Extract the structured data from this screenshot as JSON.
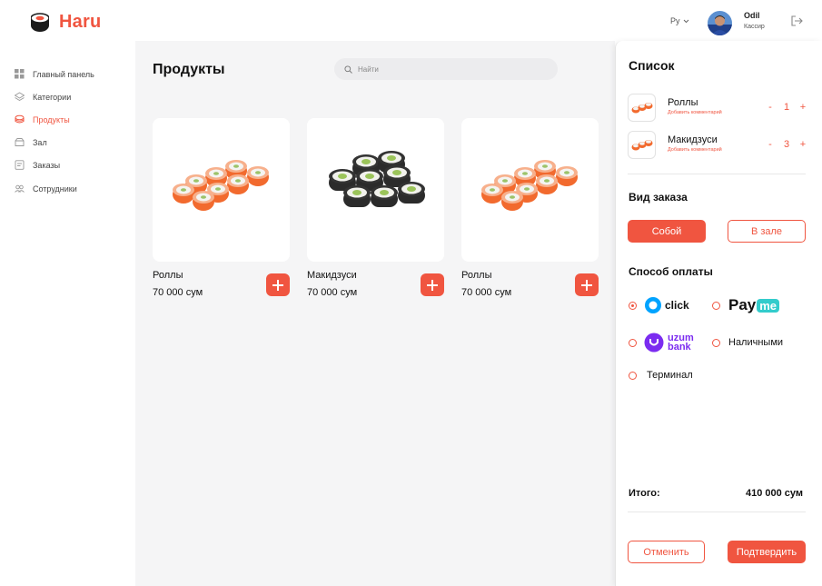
{
  "app": {
    "brand": "Haru",
    "brand_color": "#f05540"
  },
  "header": {
    "language": "Ру",
    "user_name": "Odil",
    "user_role": "Кассир"
  },
  "sidebar": {
    "items": [
      {
        "label": "Главный панель",
        "icon": "dashboard-icon",
        "active": false
      },
      {
        "label": "Категории",
        "icon": "layers-icon",
        "active": false
      },
      {
        "label": "Продукты",
        "icon": "sushi-icon",
        "active": true
      },
      {
        "label": "Зал",
        "icon": "hall-icon",
        "active": false
      },
      {
        "label": "Заказы",
        "icon": "orders-icon",
        "active": false
      },
      {
        "label": "Сотрудники",
        "icon": "users-icon",
        "active": false
      }
    ]
  },
  "main": {
    "title": "Продукты",
    "search_placeholder": "Найти",
    "products": [
      {
        "name": "Роллы",
        "price": "70 000 сум",
        "image": "salmon-rolls"
      },
      {
        "name": "Макидзуси",
        "price": "70 000 сум",
        "image": "maki-rolls"
      },
      {
        "name": "Роллы",
        "price": "70 000 сум",
        "image": "salmon-rolls"
      }
    ]
  },
  "panel": {
    "title": "Список",
    "items": [
      {
        "name": "Роллы",
        "comment": "Добавить комментарий",
        "qty": "1",
        "minus": "-",
        "plus": "+"
      },
      {
        "name": "Макидзуси",
        "comment": "Добавить комментарий",
        "qty": "3",
        "minus": "-",
        "plus": "+"
      }
    ],
    "order_type_title": "Вид заказа",
    "order_type_takeaway": "Собой",
    "order_type_hall": "В зале",
    "payment_title": "Способ оплаты",
    "payment_click": "click",
    "payment_payme_a": "Pay",
    "payment_payme_b": "me",
    "payment_uzum_a": "uzum",
    "payment_uzum_b": "bank",
    "payment_cash": "Наличными",
    "payment_terminal": "Терминал",
    "payment_selected": "click",
    "total_label": "Итого:",
    "total_value": "410 000 сум",
    "cancel_label": "Отменить",
    "confirm_label": "Подтвердить"
  }
}
